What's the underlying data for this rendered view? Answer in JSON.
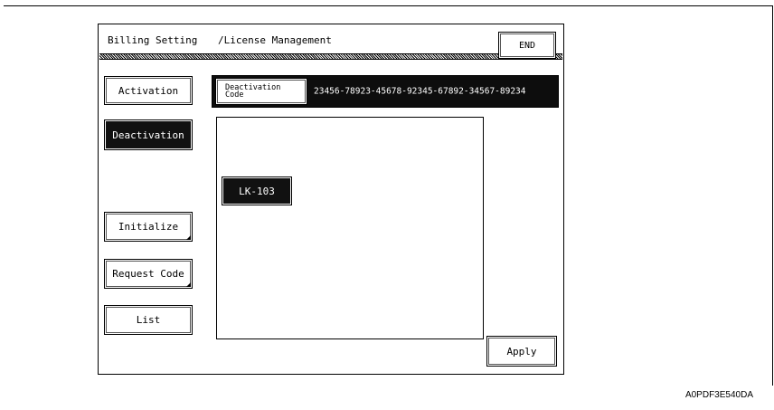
{
  "header": {
    "title": "Billing Setting",
    "subtitle": "/License Management",
    "end_label": "END"
  },
  "sidebar": {
    "items": [
      {
        "label": "Activation",
        "selected": false
      },
      {
        "label": "Deactivation",
        "selected": true
      },
      {
        "label": "Initialize",
        "selected": false
      },
      {
        "label": "Request Code",
        "selected": false
      },
      {
        "label": "List",
        "selected": false
      }
    ]
  },
  "main": {
    "code_button_label": "Deactivation Code",
    "code_value": "23456-78923-45678-92345-67892-34567-89234",
    "license_items": [
      "LK-103"
    ],
    "apply_label": "Apply"
  },
  "figure_id": "A0PDF3E540DA"
}
